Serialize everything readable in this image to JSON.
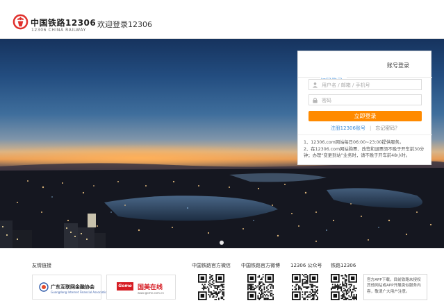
{
  "header": {
    "brand_cn": "中国铁路12306",
    "brand_en": "12306 CHINA RAILWAY",
    "welcome": "欢迎登录12306",
    "logo_color": "#e0302c"
  },
  "login": {
    "tabs": [
      "扫码登录",
      "账号登录"
    ],
    "active_tab": "扫码登录",
    "username_placeholder": "用户名 / 邮箱 / 手机号",
    "password_placeholder": "密码",
    "submit_label": "立即登录",
    "register_link": "注册12306账号",
    "separator": "|",
    "forgot_link": "忘记密码？",
    "notice_1": "1、12306.com网站每日06:00~23:00提供服务。",
    "notice_2": "2、在12306.com网站购票、改签和退票须不晚于开车前30分钟；办理“变更到站”业务时，请不晚于开车前48小时。",
    "accent_color": "#3b8bd9",
    "button_color": "#ff8a00"
  },
  "banner": {
    "active_slide": 1,
    "slide_count": 1
  },
  "footer": {
    "friend_links_title": "友情链接",
    "partners": [
      {
        "name": "广东互联网金融协会",
        "sub": "Guangdong Internet Financial Association"
      },
      {
        "badge": "Gome",
        "name": "国美在线",
        "sub": "www.gome.com.cn"
      }
    ],
    "qr_codes": [
      {
        "label": "中国铁路官方微信"
      },
      {
        "label": "中国铁路官方微博"
      },
      {
        "label": "12306 公众号"
      },
      {
        "label": "铁路12306"
      }
    ],
    "app_note": "官方APP下载，目前铁路未授权其他网站或APP开展类似服务内容，敬请广大用户注意。"
  }
}
